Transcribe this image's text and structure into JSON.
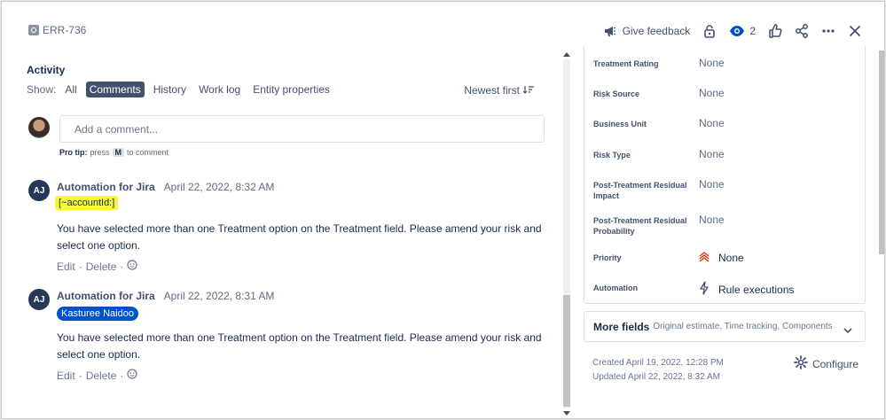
{
  "header": {
    "issue_key": "ERR-736",
    "give_feedback": "Give feedback",
    "watch_count": "2"
  },
  "activity": {
    "title": "Activity",
    "show_label": "Show:",
    "filters": [
      "All",
      "Comments",
      "History",
      "Work log",
      "Entity properties"
    ],
    "active_filter": "Comments",
    "sort_label": "Newest first",
    "comment_placeholder": "Add a comment...",
    "protip_lead": "Pro tip:",
    "protip_press": "press",
    "protip_key": "M",
    "protip_tail": "to comment"
  },
  "comments": [
    {
      "initials": "AJ",
      "author": "Automation for Jira",
      "date": "April 22, 2022, 8:32 AM",
      "mention": "[~accountId:]",
      "mention_style": "highlight",
      "body": "You have selected more than one Treatment option on the Treatment field. Please amend your risk and select one option.",
      "edit": "Edit",
      "delete": "Delete"
    },
    {
      "initials": "AJ",
      "author": "Automation for Jira",
      "date": "April 22, 2022, 8:31 AM",
      "mention": "Kasturee Naidoo",
      "mention_style": "pill",
      "body": "You have selected more than one Treatment option on the Treatment field. Please amend your risk and select one option.",
      "edit": "Edit",
      "delete": "Delete"
    }
  ],
  "fields": [
    {
      "label": "Treatment Rating",
      "value": "None"
    },
    {
      "label": "Risk Source",
      "value": "None"
    },
    {
      "label": "Business Unit",
      "value": "None"
    },
    {
      "label": "Risk Type",
      "value": "None"
    },
    {
      "label": "Post-Treatment Residual Impact",
      "value": "None"
    },
    {
      "label": "Post-Treatment Residual Probability",
      "value": "None"
    },
    {
      "label": "Priority",
      "value": "None"
    },
    {
      "label": "Automation",
      "value": "Rule executions"
    }
  ],
  "more_fields": {
    "title": "More fields",
    "subtitle": "Original estimate, Time tracking, Components"
  },
  "meta": {
    "created": "Created April 19, 2022, 12:28 PM",
    "updated": "Updated April 22, 2022, 8:32 AM",
    "configure": "Configure"
  },
  "colors": {
    "accent": "#0052cc",
    "highlight": "#f6f73a",
    "priority": "#de350b"
  }
}
